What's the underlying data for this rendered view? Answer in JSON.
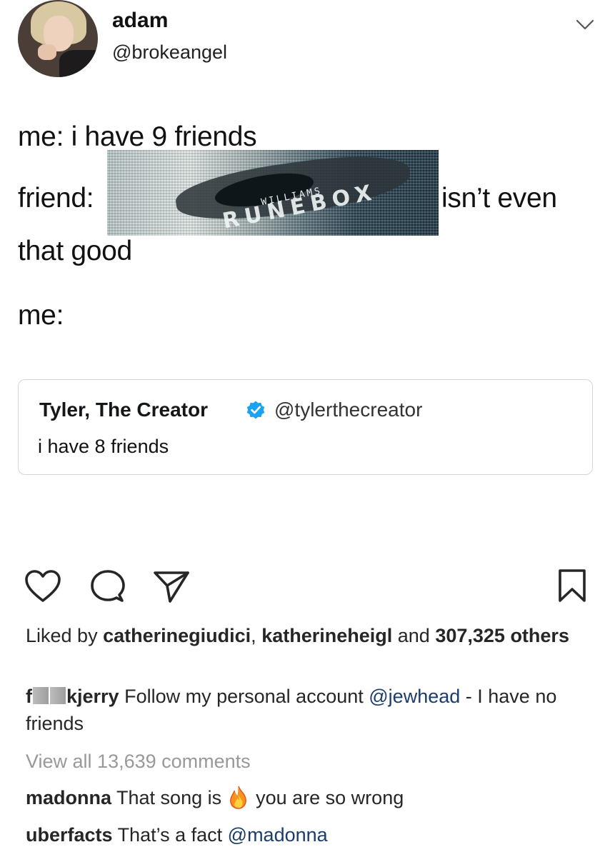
{
  "tweet": {
    "author_name": "adam",
    "author_handle": "@brokeangel",
    "lines": {
      "line1": "me: i have 9 friends",
      "line2_start": "friend:",
      "line2_end": "isn’t even",
      "line3": "that good",
      "line4": "me:"
    },
    "album_art": {
      "artist_text": "WILLIAMS",
      "album_text": "RUNEBOX"
    },
    "quoted_tweet": {
      "name": "Tyler, The Creator",
      "handle": "@tylerthecreator",
      "text": "i have 8 friends"
    }
  },
  "icons": {
    "menu": "chevron-down-icon",
    "like": "heart-icon",
    "comment": "comment-icon",
    "share": "send-icon",
    "save": "bookmark-icon",
    "verified": "verified-badge-icon",
    "emoji": "fire-emoji"
  },
  "post": {
    "likes": {
      "prefix": "Liked by",
      "user1": "catherinegiudici",
      "separator": ",",
      "user2": "katherineheigl",
      "conj": "and",
      "others": "307,325 others"
    },
    "comments": [
      {
        "user_start": "f",
        "user_end": "kjerry",
        "text": "Follow my personal account",
        "mention": "@jewhead",
        "text_end": "- I have no friends"
      },
      {
        "user": "madonna",
        "text": "That song is",
        "text_end": "you are so wrong"
      },
      {
        "user": "uberfacts",
        "text": "That’s a fact",
        "mention": "@madonna"
      }
    ],
    "view_all": "View all 13,639 comments"
  },
  "colors": {
    "text": "#262626",
    "muted": "#999999",
    "link": "#1a3d6d",
    "verified": "#1da1f2",
    "card_border": "#d2d6da"
  }
}
